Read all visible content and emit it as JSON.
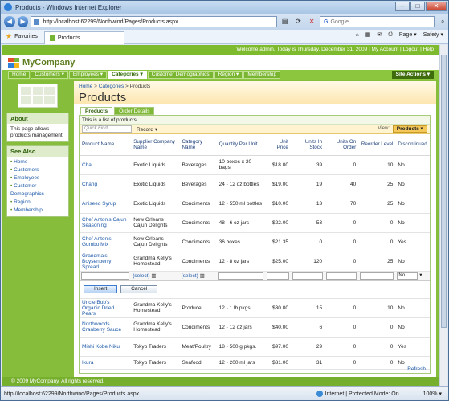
{
  "window": {
    "title": "Products - Windows Internet Explorer"
  },
  "browser": {
    "url": "http://localhost:62299/Northwind/Pages/Products.aspx",
    "search_placeholder": "Google",
    "favorites_label": "Favorites",
    "tab_title": "Products",
    "page_menu": "Page ▾",
    "safety_menu": "Safety ▾"
  },
  "site": {
    "welcome": "Welcome admin. Today is Thursday, December 31, 2009 | My Account | Logout | Help",
    "brand": "MyCompany",
    "site_actions": "Site Actions ▾",
    "footer": "© 2009 MyCompany. All rights reserved."
  },
  "menu": {
    "items": [
      {
        "label": "Home"
      },
      {
        "label": "Customers ▾"
      },
      {
        "label": "Employees ▾"
      },
      {
        "label": "Categories ▾"
      },
      {
        "label": "Customer Demographics"
      },
      {
        "label": "Region ▾"
      },
      {
        "label": "Membership"
      }
    ]
  },
  "sidebar": {
    "about_title": "About",
    "about_text": "This page allows products management.",
    "see_also_title": "See Also",
    "links": [
      {
        "label": "Home"
      },
      {
        "label": "Customers"
      },
      {
        "label": "Employees"
      },
      {
        "label": "Customer Demographics"
      },
      {
        "label": "Region"
      },
      {
        "label": "Membership"
      }
    ]
  },
  "page": {
    "crumb_home": "Home",
    "crumb_sep1": " > ",
    "crumb_cat": "Categories",
    "crumb_sep2": " > ",
    "crumb_cur": "Products",
    "title": "Products",
    "tab_products": "Products",
    "tab_orders": "Order Details",
    "description": "This is a list of products.",
    "quick_find": "Quick Find",
    "record_menu": "Record ▾",
    "view_label": "View:",
    "view_value": "Products ▾",
    "insert": "Insert",
    "cancel": "Cancel",
    "refresh": "Refresh",
    "select_text": "(select)",
    "disc_default": "No"
  },
  "columns": [
    "Product Name",
    "Supplier Company Name",
    "Category Name",
    "Quantity Per Unit",
    "Unit Price",
    "Units In Stock",
    "Units On Order",
    "Reorder Level",
    "Discontinued"
  ],
  "rows_top": [
    [
      "Chai",
      "Exotic Liquids",
      "Beverages",
      "10 boxes x 20 bags",
      "$18.00",
      "39",
      "0",
      "10",
      "No"
    ],
    [
      "Chang",
      "Exotic Liquids",
      "Beverages",
      "24 - 12 oz bottles",
      "$19.00",
      "19",
      "40",
      "25",
      "No"
    ],
    [
      "Aniseed Syrup",
      "Exotic Liquids",
      "Condiments",
      "12 - 550 ml bottles",
      "$10.00",
      "13",
      "70",
      "25",
      "No"
    ],
    [
      "Chef Anton's Cajun Seasoning",
      "New Orleans Cajun Delights",
      "Condiments",
      "48 - 6 oz jars",
      "$22.00",
      "53",
      "0",
      "0",
      "No"
    ],
    [
      "Chef Anton's Gumbo Mix",
      "New Orleans Cajun Delights",
      "Condiments",
      "36 boxes",
      "$21.35",
      "0",
      "0",
      "0",
      "Yes"
    ],
    [
      "Grandma's Boysenberry Spread",
      "Grandma Kelly's Homestead",
      "Condiments",
      "12 - 8 oz jars",
      "$25.00",
      "120",
      "0",
      "25",
      "No"
    ]
  ],
  "rows_bottom": [
    [
      "Uncle Bob's Organic Dried Pears",
      "Grandma Kelly's Homestead",
      "Produce",
      "12 - 1 lb pkgs.",
      "$30.00",
      "15",
      "0",
      "10",
      "No"
    ],
    [
      "Northwoods Cranberry Sauce",
      "Grandma Kelly's Homestead",
      "Condiments",
      "12 - 12 oz jars",
      "$40.00",
      "6",
      "0",
      "0",
      "No"
    ],
    [
      "Mishi Kobe Niku",
      "Tokyo Traders",
      "Meat/Poultry",
      "18 - 500 g pkgs.",
      "$97.00",
      "29",
      "0",
      "0",
      "Yes"
    ],
    [
      "Ikura",
      "Tokyo Traders",
      "Seafood",
      "12 - 200 ml jars",
      "$31.00",
      "31",
      "0",
      "0",
      "No"
    ]
  ],
  "status": {
    "text": "http://localhost:62299/Northwind/Pages/Products.aspx",
    "zone": "Internet | Protected Mode: On",
    "zoom": "100% ▾"
  }
}
